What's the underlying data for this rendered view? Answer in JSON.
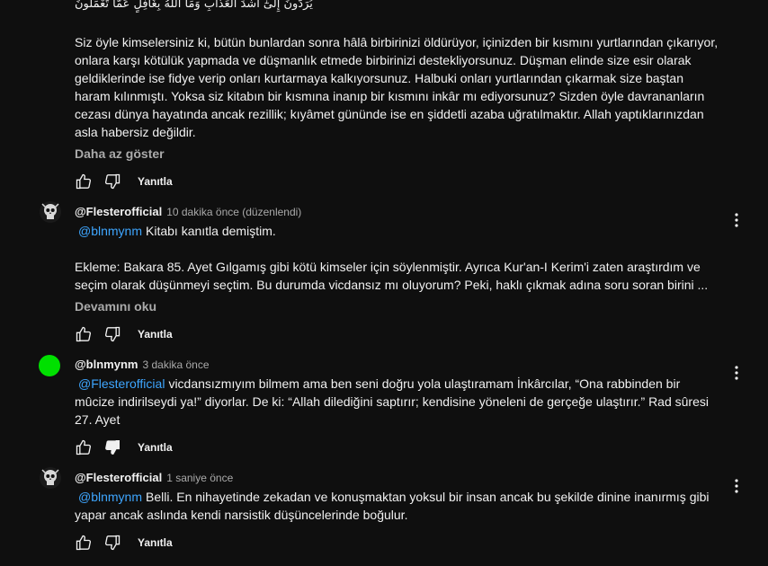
{
  "top_comment": {
    "arabic_line": "يُرَدُّونَ إِلَىٰٓ أَشَدِّ الْعَذَابِ وَمَا اللَّهُ بِغَافِلٍ عَمَّا تَعْمَلُونَ",
    "text": "Siz öyle kimselersiniz ki, bütün bunlardan sonra hâlâ birbirinizi öldürüyor, içinizden bir kısmını yurtlarından çıkarıyor,\nonlara karşı kötülük yapmada ve düşmanlık etmede birbirinizi destekliyorsunuz. Düşman elinde size esir olarak\ngeldiklerinde ise fidye verip onları kurtarmaya kalkıyorsunuz. Halbuki onları yurtlarından çıkarmak size baştan\nharam kılınmıştı. Yoksa siz kitabın bir kısmına inanıp bir kısmını inkâr mı ediyorsunuz? Sizden öyle davrananların\ncezası dünya hayatında ancak rezillik; kıyâmet gününde ise en şiddetli azaba uğratılmaktır. Allah yaptıklarınızdan\nasla habersiz değildir.",
    "more_label": "Daha az göster",
    "reply_label": "Yanıtla"
  },
  "replies": [
    {
      "author": "@Flesterofficial",
      "time": "10 dakika önce (düzenlendi)",
      "mention": "@blnmynm",
      "text": "Kitabı kanıtla demiştim.\n\nEkleme: Bakara 85. Ayet Gılgamış gibi kötü kimseler için söylenmiştir. Ayrıca Kur'an-I Kerim'i zaten araştırdım ve\nseçim olarak düşünmeyi seçtim. Bu durumda vicdansız mı oluyorum? Peki, haklı çıkmak adına soru soran birini ...",
      "more_label": "Devamını oku",
      "reply_label": "Yanıtla"
    },
    {
      "author": "@blnmynm",
      "time": "3 dakika önce",
      "mention": "@Flesterofficial",
      "text": "vicdansızmıyım bilmem ama ben seni doğru yola ulaştıramam İnkârcılar, “Ona rabbinden bir\nmûcize indirilseydi ya!” diyorlar. De ki: “Allah dilediğini saptırır; kendisine yöneleni de gerçeğe ulaştırır.” Rad sûresi\n27. Ayet",
      "reply_label": "Yanıtla"
    },
    {
      "author": "@Flesterofficial",
      "time": "1 saniye önce",
      "mention": "@blnmynm",
      "text": "Belli. En nihayetinde zekadan ve konuşmaktan yoksul bir insan ancak bu şekilde dinine inanırmış gibi\nyapar ancak aslında kendi narsistik düşüncelerinde boğulur.",
      "reply_label": "Yanıtla"
    }
  ],
  "colors": {
    "background": "#0f0f0f",
    "text": "#f1f1f1",
    "secondary": "#aaaaaa",
    "mention": "#3ea6ff",
    "avatar_green": "#00e000"
  },
  "icons": [
    "like-icon",
    "dislike-icon",
    "more-vert-icon",
    "skull-avatar"
  ]
}
